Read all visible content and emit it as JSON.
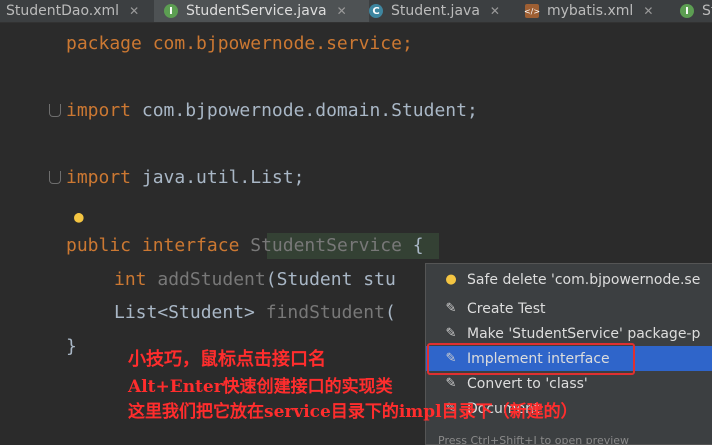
{
  "tabs": [
    {
      "label": "StudentDao.xml",
      "icon": "xml-file-icon",
      "active": false
    },
    {
      "label": "StudentService.java",
      "icon": "interface-icon",
      "icon_letter": "I",
      "icon_color": "#5c9e52",
      "active": true
    },
    {
      "label": "Student.java",
      "icon": "class-icon",
      "icon_letter": "C",
      "icon_color": "#3e86a0",
      "active": false
    },
    {
      "label": "mybatis.xml",
      "icon": "xml-file-icon",
      "active": false
    },
    {
      "label": "St",
      "icon": "interface-icon",
      "icon_letter": "I",
      "icon_color": "#5c9e52",
      "active": false
    }
  ],
  "code": {
    "package_kw": "package",
    "package_name": " com.bjpowernode.service;",
    "import_kw_1": "import",
    "import_1": " com.bjpowernode.domain.Student;",
    "import_kw_2": "import",
    "import_2": " java.util.List;",
    "public_kw": "public",
    "interface_kw": " interface ",
    "class_name": "StudentService",
    "open_brace": " {",
    "int_kw": "int",
    "method_1_name": " addStudent",
    "method_1_params": "(Student stu",
    "return_type_2": "List<Student>",
    "method_2_name": " findStudent",
    "method_2_params": "(",
    "close_brace": "}"
  },
  "popup": {
    "items": [
      {
        "label": "Safe delete 'com.bjpowernode.se",
        "icon": "bulb-icon"
      },
      {
        "label": "Create Test",
        "icon": "pencil-icon"
      },
      {
        "label": "Make 'StudentService' package-p",
        "icon": "pencil-icon"
      },
      {
        "label": "Implement interface",
        "icon": "pencil-icon",
        "selected": true
      },
      {
        "label": "Convert to 'class'",
        "icon": "pencil-icon"
      },
      {
        "label": "Document",
        "icon": "pencil-icon"
      }
    ],
    "footer": "Press Ctrl+Shift+I to open preview"
  },
  "annotation": {
    "line_1": "小技巧，鼠标点击接口名",
    "line_2": "Alt+Enter快速创建接口的实现类",
    "line_3": "这里我们把它放在service目录下的impl目录下（新建的）"
  },
  "colors": {
    "background": "#2b2b2b",
    "keyword": "#cc7832",
    "text": "#a9b7c6",
    "selection": "#2f65ca",
    "annotation": "#ff2d2d"
  }
}
